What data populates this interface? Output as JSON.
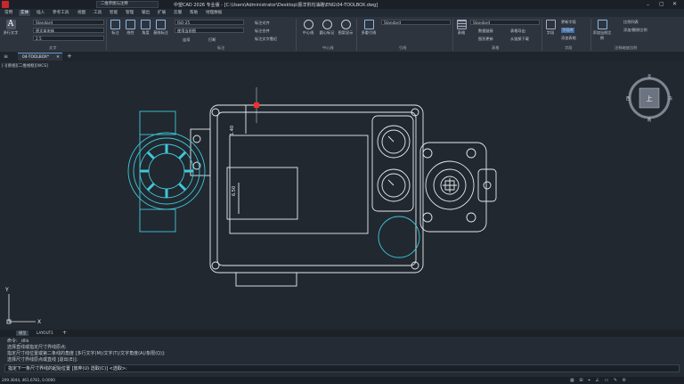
{
  "window": {
    "title": "中望CAD 2026 专业版 - [C:\\Users\\Administrator\\Desktop\\振洋供均油路\\ENG\\04-TOOLBOX.dwg]",
    "workspace": "二维草图与注释"
  },
  "ribbon_tabs": [
    "常用",
    "实体",
    "插入",
    "参考工具",
    "视图",
    "工具",
    "智能",
    "管理",
    "输出",
    "扩展",
    "云服",
    "帮助",
    "地理数据"
  ],
  "ribbon": {
    "annotation": {
      "multiline_text": "多行文字",
      "text_style": "Standard",
      "font": "原文本宋体",
      "height": "2.5",
      "group_label": "文字"
    },
    "dimension": {
      "buttons": [
        "标注",
        "线性",
        "角度",
        "基线标注"
      ],
      "dim_style": "ISO-25",
      "layer": "使用当前图",
      "buttons2": [
        "连续",
        "打断"
      ],
      "small": [
        "标注对齐",
        "标注合并",
        "标注文字靠近"
      ],
      "group_label": "标注"
    },
    "centerline": {
      "buttons": [
        "中心线",
        "圆心标记",
        "图案显示"
      ],
      "group_label": "中心线"
    },
    "leader": {
      "multileader": "多重引线",
      "style": "Standard",
      "group_label": "引线"
    },
    "table": {
      "table_label": "表格",
      "style": "Standard",
      "small": [
        "数据链接",
        "表格导出",
        "图形更新",
        "从链接下载"
      ],
      "group_label": "表格"
    },
    "fields": {
      "buttons": [
        "字段"
      ],
      "small": [
        "更新字段",
        "字段库",
        "添加表格"
      ],
      "group_label": "字段"
    },
    "scale": {
      "label": "添加当前比例",
      "small": [
        "比例列表",
        "添加/删除比例"
      ],
      "group_label": "注释缩放比例"
    }
  },
  "document_tab": "04-TOOLBOX*",
  "view_label": "[-][俯视][二维线框][WCS]",
  "viewcube": {
    "face": "上",
    "north": "北",
    "south": "南",
    "east": "东",
    "west": "西"
  },
  "dimension_texts": [
    "1.40",
    "6.50"
  ],
  "ucs": {
    "x": "X",
    "y": "Y"
  },
  "layout_tabs": [
    "模型",
    "LAYOUT1"
  ],
  "command_history": [
    "命令: _dlis",
    "选择直线或指定尺寸界线原点:",
    "指定尺寸线位置或第二条线的角度 [多行文字(M)/文字(T)/文字角度(A)/象限(Q)]:",
    "选择尺寸界线原点或直线 [退出(E)]:"
  ],
  "command_prompt": "指定下一条尺寸界线的起始位置 [放弃(U) 选取(C)] <选取>:",
  "coords": "209.3044, 461.6781, 0.0000",
  "colors": {
    "accent": "#6aa0d8",
    "cyan": "#3fc7d8",
    "white": "#e8eaec",
    "cursor": "#ff2b2b"
  }
}
